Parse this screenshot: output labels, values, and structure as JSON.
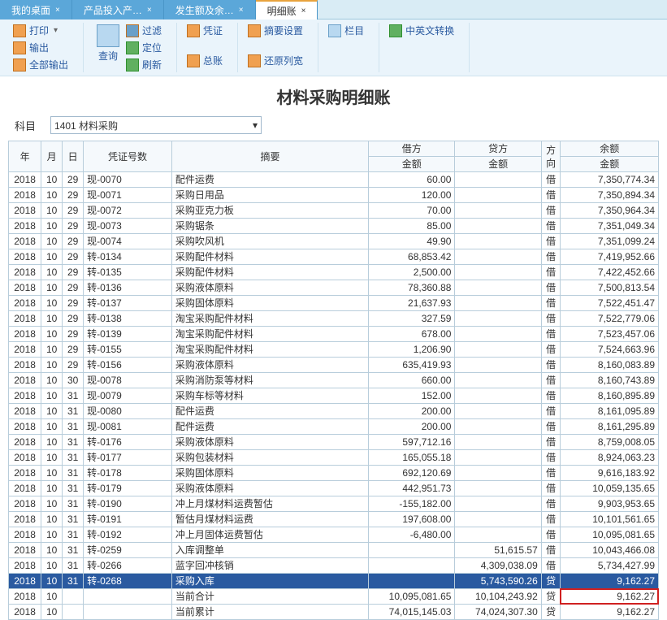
{
  "tabs": [
    {
      "label": "我的桌面",
      "closable": true,
      "active": false
    },
    {
      "label": "产品投入产…",
      "closable": true,
      "active": false
    },
    {
      "label": "发生额及余…",
      "closable": true,
      "active": false
    },
    {
      "label": "明细账",
      "closable": true,
      "active": true
    }
  ],
  "toolbar": {
    "print": "打印",
    "output": "输出",
    "outall": "全部输出",
    "query": "查询",
    "filter": "过滤",
    "locate": "定位",
    "refresh": "刷新",
    "voucher": "凭证",
    "general": "总账",
    "summaryset": "摘要设置",
    "restore": "还原列宽",
    "column": "栏目",
    "translate": "中英文转换"
  },
  "page_title": "材料采购明细账",
  "subject": {
    "label": "科目",
    "value": "1401 材料采购"
  },
  "headers": {
    "year": "年",
    "month": "月",
    "day": "日",
    "voucherno": "凭证号数",
    "summary": "摘要",
    "debit": "借方",
    "credit": "贷方",
    "direction": "方向",
    "balance": "余额",
    "amount": "金额"
  },
  "rows": [
    {
      "y": "2018",
      "m": "10",
      "d": "29",
      "vn": "现-0070",
      "sum": "配件运费",
      "deb": "60.00",
      "cre": "",
      "dir": "借",
      "bal": "7,350,774.34"
    },
    {
      "y": "2018",
      "m": "10",
      "d": "29",
      "vn": "现-0071",
      "sum": "采购日用品",
      "deb": "120.00",
      "cre": "",
      "dir": "借",
      "bal": "7,350,894.34"
    },
    {
      "y": "2018",
      "m": "10",
      "d": "29",
      "vn": "现-0072",
      "sum": "采购亚克力板",
      "deb": "70.00",
      "cre": "",
      "dir": "借",
      "bal": "7,350,964.34"
    },
    {
      "y": "2018",
      "m": "10",
      "d": "29",
      "vn": "现-0073",
      "sum": "采购锯条",
      "deb": "85.00",
      "cre": "",
      "dir": "借",
      "bal": "7,351,049.34"
    },
    {
      "y": "2018",
      "m": "10",
      "d": "29",
      "vn": "现-0074",
      "sum": "采购吹风机",
      "deb": "49.90",
      "cre": "",
      "dir": "借",
      "bal": "7,351,099.24"
    },
    {
      "y": "2018",
      "m": "10",
      "d": "29",
      "vn": "转-0134",
      "sum": "采购配件材料",
      "deb": "68,853.42",
      "cre": "",
      "dir": "借",
      "bal": "7,419,952.66"
    },
    {
      "y": "2018",
      "m": "10",
      "d": "29",
      "vn": "转-0135",
      "sum": "采购配件材料",
      "deb": "2,500.00",
      "cre": "",
      "dir": "借",
      "bal": "7,422,452.66"
    },
    {
      "y": "2018",
      "m": "10",
      "d": "29",
      "vn": "转-0136",
      "sum": "采购液体原料",
      "deb": "78,360.88",
      "cre": "",
      "dir": "借",
      "bal": "7,500,813.54"
    },
    {
      "y": "2018",
      "m": "10",
      "d": "29",
      "vn": "转-0137",
      "sum": "采购固体原料",
      "deb": "21,637.93",
      "cre": "",
      "dir": "借",
      "bal": "7,522,451.47"
    },
    {
      "y": "2018",
      "m": "10",
      "d": "29",
      "vn": "转-0138",
      "sum": "淘宝采购配件材料",
      "deb": "327.59",
      "cre": "",
      "dir": "借",
      "bal": "7,522,779.06"
    },
    {
      "y": "2018",
      "m": "10",
      "d": "29",
      "vn": "转-0139",
      "sum": "淘宝采购配件材料",
      "deb": "678.00",
      "cre": "",
      "dir": "借",
      "bal": "7,523,457.06"
    },
    {
      "y": "2018",
      "m": "10",
      "d": "29",
      "vn": "转-0155",
      "sum": "淘宝采购配件材料",
      "deb": "1,206.90",
      "cre": "",
      "dir": "借",
      "bal": "7,524,663.96"
    },
    {
      "y": "2018",
      "m": "10",
      "d": "29",
      "vn": "转-0156",
      "sum": "采购液体原料",
      "deb": "635,419.93",
      "cre": "",
      "dir": "借",
      "bal": "8,160,083.89"
    },
    {
      "y": "2018",
      "m": "10",
      "d": "30",
      "vn": "现-0078",
      "sum": "采购消防泵等材料",
      "deb": "660.00",
      "cre": "",
      "dir": "借",
      "bal": "8,160,743.89"
    },
    {
      "y": "2018",
      "m": "10",
      "d": "31",
      "vn": "现-0079",
      "sum": "采购车标等材料",
      "deb": "152.00",
      "cre": "",
      "dir": "借",
      "bal": "8,160,895.89"
    },
    {
      "y": "2018",
      "m": "10",
      "d": "31",
      "vn": "现-0080",
      "sum": "配件运费",
      "deb": "200.00",
      "cre": "",
      "dir": "借",
      "bal": "8,161,095.89"
    },
    {
      "y": "2018",
      "m": "10",
      "d": "31",
      "vn": "现-0081",
      "sum": "配件运费",
      "deb": "200.00",
      "cre": "",
      "dir": "借",
      "bal": "8,161,295.89"
    },
    {
      "y": "2018",
      "m": "10",
      "d": "31",
      "vn": "转-0176",
      "sum": "采购液体原料",
      "deb": "597,712.16",
      "cre": "",
      "dir": "借",
      "bal": "8,759,008.05"
    },
    {
      "y": "2018",
      "m": "10",
      "d": "31",
      "vn": "转-0177",
      "sum": "采购包装材料",
      "deb": "165,055.18",
      "cre": "",
      "dir": "借",
      "bal": "8,924,063.23"
    },
    {
      "y": "2018",
      "m": "10",
      "d": "31",
      "vn": "转-0178",
      "sum": "采购固体原料",
      "deb": "692,120.69",
      "cre": "",
      "dir": "借",
      "bal": "9,616,183.92"
    },
    {
      "y": "2018",
      "m": "10",
      "d": "31",
      "vn": "转-0179",
      "sum": "采购液体原料",
      "deb": "442,951.73",
      "cre": "",
      "dir": "借",
      "bal": "10,059,135.65"
    },
    {
      "y": "2018",
      "m": "10",
      "d": "31",
      "vn": "转-0190",
      "sum": "冲上月煤材料运费暂估",
      "deb": "-155,182.00",
      "cre": "",
      "dir": "借",
      "bal": "9,903,953.65"
    },
    {
      "y": "2018",
      "m": "10",
      "d": "31",
      "vn": "转-0191",
      "sum": "暂估月煤材料运费",
      "deb": "197,608.00",
      "cre": "",
      "dir": "借",
      "bal": "10,101,561.65"
    },
    {
      "y": "2018",
      "m": "10",
      "d": "31",
      "vn": "转-0192",
      "sum": "冲上月固体运费暂估",
      "deb": "-6,480.00",
      "cre": "",
      "dir": "借",
      "bal": "10,095,081.65"
    },
    {
      "y": "2018",
      "m": "10",
      "d": "31",
      "vn": "转-0259",
      "sum": "入库调整单",
      "deb": "",
      "cre": "51,615.57",
      "dir": "借",
      "bal": "10,043,466.08"
    },
    {
      "y": "2018",
      "m": "10",
      "d": "31",
      "vn": "转-0266",
      "sum": "蓝字回冲核销",
      "deb": "",
      "cre": "4,309,038.09",
      "dir": "借",
      "bal": "5,734,427.99"
    },
    {
      "y": "2018",
      "m": "10",
      "d": "31",
      "vn": "转-0268",
      "sum": "采购入库",
      "deb": "",
      "cre": "5,743,590.26",
      "dir": "贷",
      "bal": "9,162.27",
      "selected": true
    },
    {
      "y": "2018",
      "m": "10",
      "d": "",
      "vn": "",
      "sum": "当前合计",
      "deb": "10,095,081.65",
      "cre": "10,104,243.92",
      "dir": "贷",
      "bal": "9,162.27",
      "redbal": true
    },
    {
      "y": "2018",
      "m": "10",
      "d": "",
      "vn": "",
      "sum": "当前累计",
      "deb": "74,015,145.03",
      "cre": "74,024,307.30",
      "dir": "贷",
      "bal": "9,162.27"
    }
  ]
}
